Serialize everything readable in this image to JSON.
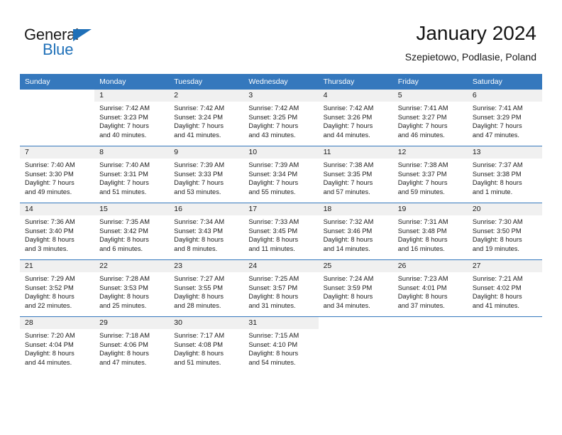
{
  "brand": {
    "name_top": "General",
    "name_bottom": "Blue",
    "accent_color": "#1f70b8"
  },
  "header": {
    "title": "January 2024",
    "subtitle": "Szepietowo, Podlasie, Poland"
  },
  "calendar": {
    "header_bg": "#3578bd",
    "daynum_bg": "#f0f0f0",
    "weekday_headers": [
      "Sunday",
      "Monday",
      "Tuesday",
      "Wednesday",
      "Thursday",
      "Friday",
      "Saturday"
    ],
    "weeks": [
      [
        {
          "day": "",
          "sunrise": "",
          "sunset": "",
          "daylight_line1": "",
          "daylight_line2": ""
        },
        {
          "day": "1",
          "sunrise": "Sunrise: 7:42 AM",
          "sunset": "Sunset: 3:23 PM",
          "daylight_line1": "Daylight: 7 hours",
          "daylight_line2": "and 40 minutes."
        },
        {
          "day": "2",
          "sunrise": "Sunrise: 7:42 AM",
          "sunset": "Sunset: 3:24 PM",
          "daylight_line1": "Daylight: 7 hours",
          "daylight_line2": "and 41 minutes."
        },
        {
          "day": "3",
          "sunrise": "Sunrise: 7:42 AM",
          "sunset": "Sunset: 3:25 PM",
          "daylight_line1": "Daylight: 7 hours",
          "daylight_line2": "and 43 minutes."
        },
        {
          "day": "4",
          "sunrise": "Sunrise: 7:42 AM",
          "sunset": "Sunset: 3:26 PM",
          "daylight_line1": "Daylight: 7 hours",
          "daylight_line2": "and 44 minutes."
        },
        {
          "day": "5",
          "sunrise": "Sunrise: 7:41 AM",
          "sunset": "Sunset: 3:27 PM",
          "daylight_line1": "Daylight: 7 hours",
          "daylight_line2": "and 46 minutes."
        },
        {
          "day": "6",
          "sunrise": "Sunrise: 7:41 AM",
          "sunset": "Sunset: 3:29 PM",
          "daylight_line1": "Daylight: 7 hours",
          "daylight_line2": "and 47 minutes."
        }
      ],
      [
        {
          "day": "7",
          "sunrise": "Sunrise: 7:40 AM",
          "sunset": "Sunset: 3:30 PM",
          "daylight_line1": "Daylight: 7 hours",
          "daylight_line2": "and 49 minutes."
        },
        {
          "day": "8",
          "sunrise": "Sunrise: 7:40 AM",
          "sunset": "Sunset: 3:31 PM",
          "daylight_line1": "Daylight: 7 hours",
          "daylight_line2": "and 51 minutes."
        },
        {
          "day": "9",
          "sunrise": "Sunrise: 7:39 AM",
          "sunset": "Sunset: 3:33 PM",
          "daylight_line1": "Daylight: 7 hours",
          "daylight_line2": "and 53 minutes."
        },
        {
          "day": "10",
          "sunrise": "Sunrise: 7:39 AM",
          "sunset": "Sunset: 3:34 PM",
          "daylight_line1": "Daylight: 7 hours",
          "daylight_line2": "and 55 minutes."
        },
        {
          "day": "11",
          "sunrise": "Sunrise: 7:38 AM",
          "sunset": "Sunset: 3:35 PM",
          "daylight_line1": "Daylight: 7 hours",
          "daylight_line2": "and 57 minutes."
        },
        {
          "day": "12",
          "sunrise": "Sunrise: 7:38 AM",
          "sunset": "Sunset: 3:37 PM",
          "daylight_line1": "Daylight: 7 hours",
          "daylight_line2": "and 59 minutes."
        },
        {
          "day": "13",
          "sunrise": "Sunrise: 7:37 AM",
          "sunset": "Sunset: 3:38 PM",
          "daylight_line1": "Daylight: 8 hours",
          "daylight_line2": "and 1 minute."
        }
      ],
      [
        {
          "day": "14",
          "sunrise": "Sunrise: 7:36 AM",
          "sunset": "Sunset: 3:40 PM",
          "daylight_line1": "Daylight: 8 hours",
          "daylight_line2": "and 3 minutes."
        },
        {
          "day": "15",
          "sunrise": "Sunrise: 7:35 AM",
          "sunset": "Sunset: 3:42 PM",
          "daylight_line1": "Daylight: 8 hours",
          "daylight_line2": "and 6 minutes."
        },
        {
          "day": "16",
          "sunrise": "Sunrise: 7:34 AM",
          "sunset": "Sunset: 3:43 PM",
          "daylight_line1": "Daylight: 8 hours",
          "daylight_line2": "and 8 minutes."
        },
        {
          "day": "17",
          "sunrise": "Sunrise: 7:33 AM",
          "sunset": "Sunset: 3:45 PM",
          "daylight_line1": "Daylight: 8 hours",
          "daylight_line2": "and 11 minutes."
        },
        {
          "day": "18",
          "sunrise": "Sunrise: 7:32 AM",
          "sunset": "Sunset: 3:46 PM",
          "daylight_line1": "Daylight: 8 hours",
          "daylight_line2": "and 14 minutes."
        },
        {
          "day": "19",
          "sunrise": "Sunrise: 7:31 AM",
          "sunset": "Sunset: 3:48 PM",
          "daylight_line1": "Daylight: 8 hours",
          "daylight_line2": "and 16 minutes."
        },
        {
          "day": "20",
          "sunrise": "Sunrise: 7:30 AM",
          "sunset": "Sunset: 3:50 PM",
          "daylight_line1": "Daylight: 8 hours",
          "daylight_line2": "and 19 minutes."
        }
      ],
      [
        {
          "day": "21",
          "sunrise": "Sunrise: 7:29 AM",
          "sunset": "Sunset: 3:52 PM",
          "daylight_line1": "Daylight: 8 hours",
          "daylight_line2": "and 22 minutes."
        },
        {
          "day": "22",
          "sunrise": "Sunrise: 7:28 AM",
          "sunset": "Sunset: 3:53 PM",
          "daylight_line1": "Daylight: 8 hours",
          "daylight_line2": "and 25 minutes."
        },
        {
          "day": "23",
          "sunrise": "Sunrise: 7:27 AM",
          "sunset": "Sunset: 3:55 PM",
          "daylight_line1": "Daylight: 8 hours",
          "daylight_line2": "and 28 minutes."
        },
        {
          "day": "24",
          "sunrise": "Sunrise: 7:25 AM",
          "sunset": "Sunset: 3:57 PM",
          "daylight_line1": "Daylight: 8 hours",
          "daylight_line2": "and 31 minutes."
        },
        {
          "day": "25",
          "sunrise": "Sunrise: 7:24 AM",
          "sunset": "Sunset: 3:59 PM",
          "daylight_line1": "Daylight: 8 hours",
          "daylight_line2": "and 34 minutes."
        },
        {
          "day": "26",
          "sunrise": "Sunrise: 7:23 AM",
          "sunset": "Sunset: 4:01 PM",
          "daylight_line1": "Daylight: 8 hours",
          "daylight_line2": "and 37 minutes."
        },
        {
          "day": "27",
          "sunrise": "Sunrise: 7:21 AM",
          "sunset": "Sunset: 4:02 PM",
          "daylight_line1": "Daylight: 8 hours",
          "daylight_line2": "and 41 minutes."
        }
      ],
      [
        {
          "day": "28",
          "sunrise": "Sunrise: 7:20 AM",
          "sunset": "Sunset: 4:04 PM",
          "daylight_line1": "Daylight: 8 hours",
          "daylight_line2": "and 44 minutes."
        },
        {
          "day": "29",
          "sunrise": "Sunrise: 7:18 AM",
          "sunset": "Sunset: 4:06 PM",
          "daylight_line1": "Daylight: 8 hours",
          "daylight_line2": "and 47 minutes."
        },
        {
          "day": "30",
          "sunrise": "Sunrise: 7:17 AM",
          "sunset": "Sunset: 4:08 PM",
          "daylight_line1": "Daylight: 8 hours",
          "daylight_line2": "and 51 minutes."
        },
        {
          "day": "31",
          "sunrise": "Sunrise: 7:15 AM",
          "sunset": "Sunset: 4:10 PM",
          "daylight_line1": "Daylight: 8 hours",
          "daylight_line2": "and 54 minutes."
        },
        {
          "day": "",
          "sunrise": "",
          "sunset": "",
          "daylight_line1": "",
          "daylight_line2": ""
        },
        {
          "day": "",
          "sunrise": "",
          "sunset": "",
          "daylight_line1": "",
          "daylight_line2": ""
        },
        {
          "day": "",
          "sunrise": "",
          "sunset": "",
          "daylight_line1": "",
          "daylight_line2": ""
        }
      ]
    ]
  }
}
